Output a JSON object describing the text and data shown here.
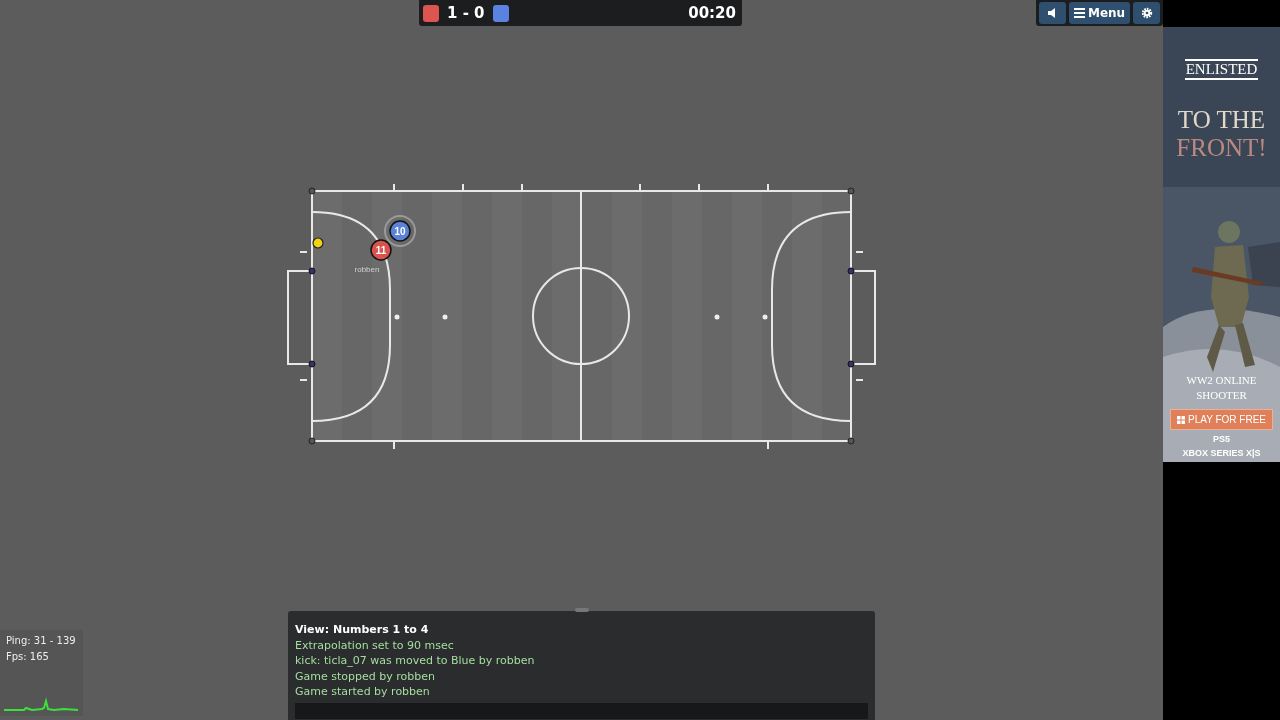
{
  "score_bar": {
    "red_score": "1",
    "separator": "-",
    "blue_score": "0",
    "time": "00:20"
  },
  "top_buttons": [
    {
      "kind": "sound"
    },
    {
      "kind": "menu",
      "label": "Menu"
    },
    {
      "kind": "settings"
    }
  ],
  "field": {
    "players": [
      {
        "number": "10",
        "color": "#5a82d8"
      },
      {
        "number": "11",
        "color": "#d9534f",
        "name": "robben"
      }
    ]
  },
  "chat": {
    "messages": [
      {
        "kind": "info",
        "text": "View: Numbers 1 to 4"
      },
      {
        "kind": "notice",
        "text": "Extrapolation set to 90 msec"
      },
      {
        "kind": "notice",
        "text": "kick: ticla_07 was moved to Blue by robben"
      },
      {
        "kind": "notice",
        "text": "Game stopped by robben"
      },
      {
        "kind": "notice",
        "text": "Game started by robben"
      }
    ]
  },
  "stats": {
    "ping": "Ping: 31 - 139",
    "fps": "Fps: 165"
  },
  "ad": {
    "logo": "ENLISTED",
    "headline_1": "TO THE",
    "headline_2": "FRONT!",
    "tagline": "WW2 ONLINE SHOOTER",
    "cta": "PLAY FOR FREE",
    "platform_1": "PS5",
    "platform_2": "XBOX SERIES X|S"
  }
}
